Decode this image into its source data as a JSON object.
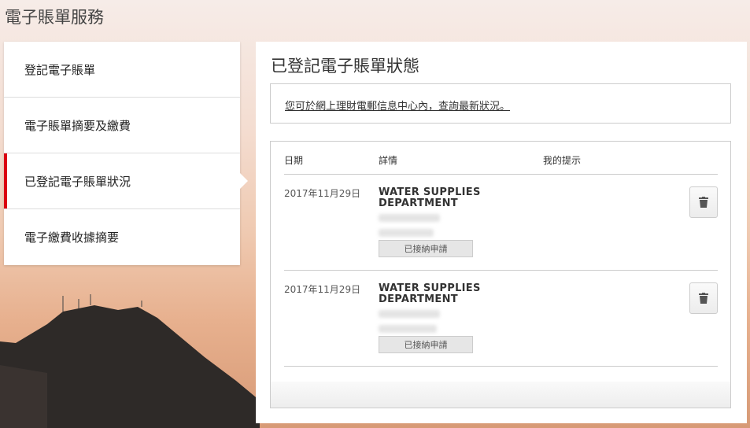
{
  "page_title": "電子賬單服務",
  "sidebar": {
    "items": [
      {
        "label": "登記電子賬單"
      },
      {
        "label": "電子賬單摘要及繳費"
      },
      {
        "label": "已登記電子賬單狀況"
      },
      {
        "label": "電子繳費收據摘要"
      }
    ],
    "active_index": 2,
    "accent_color": "#db0011"
  },
  "main": {
    "title": "已登記電子賬單狀態",
    "info_link": "您可於網上理財電郵信息中心內，查詢最新狀況。",
    "table": {
      "headers": {
        "date": "日期",
        "details": "詳情",
        "reminder": "我的提示"
      },
      "rows": [
        {
          "date": "2017年11月29日",
          "name": "WATER SUPPLIES DEPARTMENT",
          "status": "已接納申請",
          "delete_icon": "trash-icon"
        },
        {
          "date": "2017年11月29日",
          "name": "WATER SUPPLIES DEPARTMENT",
          "status": "已接納申請",
          "delete_icon": "trash-icon"
        }
      ]
    }
  }
}
